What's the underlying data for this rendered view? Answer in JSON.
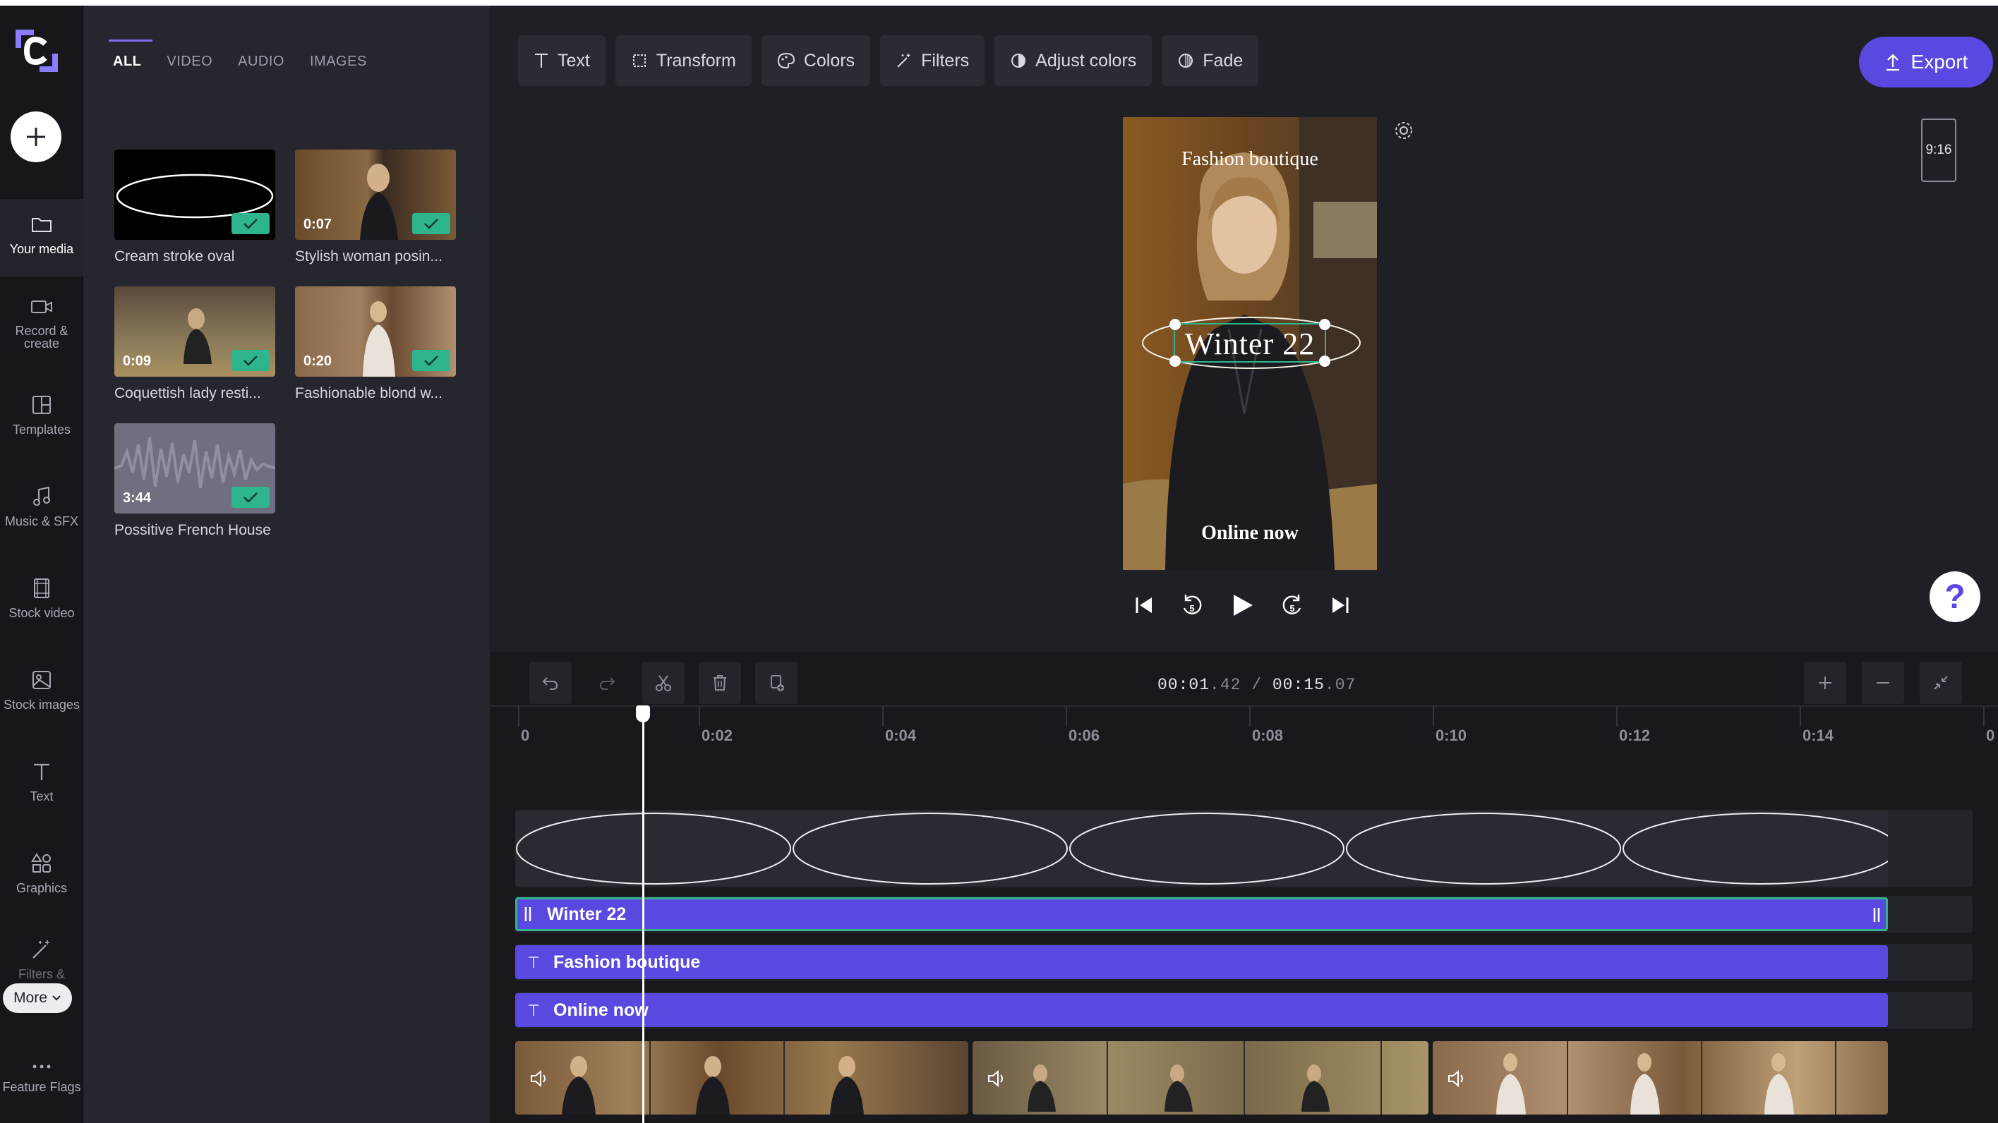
{
  "rail": {
    "items": [
      {
        "label": "Your media"
      },
      {
        "label": "Record & create"
      },
      {
        "label": "Templates"
      },
      {
        "label": "Music & SFX"
      },
      {
        "label": "Stock video"
      },
      {
        "label": "Stock images"
      },
      {
        "label": "Text"
      },
      {
        "label": "Graphics"
      },
      {
        "label": "Filters &"
      },
      {
        "label": "Feature Flags"
      }
    ],
    "more_label": "More"
  },
  "media": {
    "tabs": [
      "ALL",
      "VIDEO",
      "AUDIO",
      "IMAGES"
    ],
    "items": [
      {
        "name": "Cream stroke oval",
        "duration": ""
      },
      {
        "name": "Stylish woman posin...",
        "duration": "0:07"
      },
      {
        "name": "Coquettish lady resti...",
        "duration": "0:09"
      },
      {
        "name": "Fashionable blond w...",
        "duration": "0:20"
      },
      {
        "name": "Possitive French House",
        "duration": "3:44"
      }
    ]
  },
  "toolbar": {
    "buttons": [
      "Text",
      "Transform",
      "Colors",
      "Filters",
      "Adjust colors",
      "Fade"
    ],
    "export_label": "Export"
  },
  "preview": {
    "aspect_ratio": "9:16",
    "title_text": "Fashion boutique",
    "main_text": "Winter 22",
    "footer_text": "Online now",
    "help_label": "?"
  },
  "timeline": {
    "current_time_main": "00:01",
    "current_time_frac": ".42",
    "separator": "/",
    "total_time_main": "00:15",
    "total_time_frac": ".07",
    "ruler_ticks": [
      "0",
      "0:02",
      "0:04",
      "0:06",
      "0:08",
      "0:10",
      "0:12",
      "0:14",
      "0"
    ],
    "text_tracks": [
      "Winter 22",
      "Fashion boutique",
      "Online now"
    ]
  },
  "colors": {
    "accent": "#5a49e0",
    "check": "#2fb58d",
    "panel": "#26262e",
    "background": "#1f1f26"
  }
}
